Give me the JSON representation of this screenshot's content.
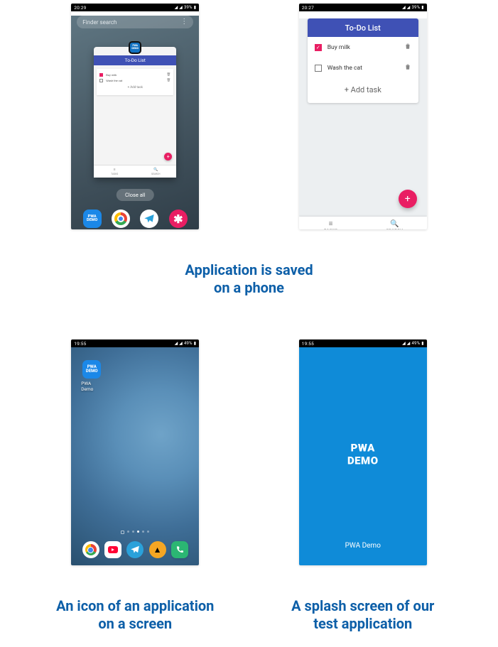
{
  "row1": {
    "phone1": {
      "status": {
        "time": "20:29",
        "indicators": "📧 ⬇",
        "battery": "39%",
        "signals": "📶 📶"
      },
      "search": {
        "placeholder": "Finder search"
      },
      "card": {
        "badge": "PWA DEMO",
        "title": "To-Do List",
        "tasks": [
          {
            "label": "Buy milk",
            "done": true
          },
          {
            "label": "Wash the cat",
            "done": false
          }
        ],
        "add": "+ Add task",
        "tabs": [
          {
            "icon": "≡",
            "label": "TASKS"
          },
          {
            "icon": "🔍",
            "label": "SEARCH"
          }
        ]
      },
      "closeAll": "Close all",
      "dock": {
        "pwa": "PWA\nDEMO"
      }
    },
    "phone2": {
      "status": {
        "time": "20:27",
        "indicators": "⬇",
        "battery": "39%"
      },
      "header": "To-Do List",
      "tasks": [
        {
          "label": "Buy milk",
          "done": true
        },
        {
          "label": "Wash the cat",
          "done": false
        }
      ],
      "add": "+ Add task",
      "tabs": [
        {
          "icon": "≡",
          "label": "TASKS"
        },
        {
          "icon": "🔍",
          "label": "SEARCH"
        }
      ]
    },
    "caption": "Application is saved\non a phone"
  },
  "row2": {
    "phone3": {
      "status": {
        "time": "19:55",
        "indicators": "📧 ⬇",
        "battery": "49%"
      },
      "appIcon": {
        "text": "PWA\nDEMO",
        "label": "PWA Demo"
      }
    },
    "phone4": {
      "status": {
        "time": "19:55",
        "indicators": "📧 ⬇",
        "battery": "49%"
      },
      "title": "PWA\nDEMO",
      "subtitle": "PWA Demo"
    },
    "caption3": "An icon of an application\non a screen",
    "caption4": "A splash screen of our\ntest application"
  }
}
